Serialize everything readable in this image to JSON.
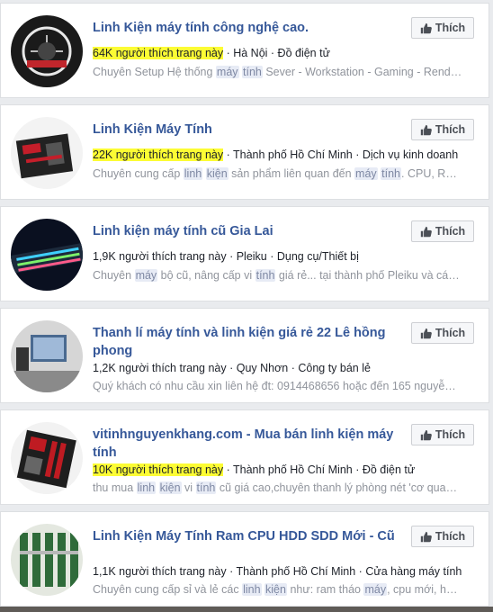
{
  "like_label": "Thích",
  "results": [
    {
      "title": "Linh Kiện máy tính công nghệ cao.",
      "likes": "64K người thích trang này",
      "highlight": true,
      "meta_rest": " · Hà Nội · Đồ điện tử",
      "desc": [
        {
          "t": "Chuyên Setup Hệ thống "
        },
        {
          "t": "máy",
          "k": true
        },
        {
          "t": " "
        },
        {
          "t": "tính",
          "k": true
        },
        {
          "t": " Sever - Workstation - Gaming - Rend…"
        }
      ]
    },
    {
      "title": "Linh Kiện Máy Tính",
      "likes": "22K người thích trang này",
      "highlight": true,
      "meta_rest": " · Thành phố Hồ Chí Minh · Dịch vụ kinh doanh",
      "desc": [
        {
          "t": "Chuyên cung cấp "
        },
        {
          "t": "linh",
          "k": true
        },
        {
          "t": " "
        },
        {
          "t": "kiện",
          "k": true
        },
        {
          "t": " sản phẩm liên quan đến "
        },
        {
          "t": "máy",
          "k": true
        },
        {
          "t": " "
        },
        {
          "t": "tính",
          "k": true
        },
        {
          "t": ". CPU, R…"
        }
      ]
    },
    {
      "title": "Linh kiện máy tính cũ Gia Lai",
      "likes": "1,9K người thích trang này",
      "highlight": false,
      "meta_rest": " · Pleiku · Dụng cụ/Thiết bị",
      "desc": [
        {
          "t": "Chuyên "
        },
        {
          "t": "máy",
          "k": true
        },
        {
          "t": " bộ cũ, nâng cấp vi "
        },
        {
          "t": "tính",
          "k": true
        },
        {
          "t": " giá rẻ... tại thành phố Pleiku và cá…"
        }
      ]
    },
    {
      "title": "Thanh lí máy tính và linh kiện giá rẻ 22 Lê hồng phong",
      "likes": "1,2K người thích trang này",
      "highlight": false,
      "meta_rest": " · Quy Nhơn · Công ty bán lẻ",
      "desc": [
        {
          "t": "Quý khách có nhu cầu xin liên hệ đt: 0914468656 hoặc đến 165 nguyễ…"
        }
      ]
    },
    {
      "title": "vitinhnguyenkhang.com - Mua bán linh kiện máy tính",
      "likes": "10K người thích trang này",
      "highlight": true,
      "meta_rest": " · Thành phố Hồ Chí Minh · Đồ điện tử",
      "desc": [
        {
          "t": "thu mua "
        },
        {
          "t": "linh",
          "k": true
        },
        {
          "t": " "
        },
        {
          "t": "kiện",
          "k": true
        },
        {
          "t": " vi "
        },
        {
          "t": "tính",
          "k": true
        },
        {
          "t": " cũ giá cao,chuyên thanh lý phòng nét 'cơ qua…"
        }
      ]
    },
    {
      "title": "Linh Kiện Máy Tính Ram CPU HDD SDD Mới - Cũ",
      "likes": "1,1K người thích trang này",
      "highlight": false,
      "meta_rest": " · Thành phố Hồ Chí Minh · Cửa hàng ",
      "meta_tail": [
        {
          "t": "máy",
          "k": true
        },
        {
          "t": " "
        },
        {
          "t": "tính",
          "k": true
        }
      ],
      "desc": [
        {
          "t": "Chuyên cung cấp sỉ và lẻ các "
        },
        {
          "t": "linh",
          "k": true
        },
        {
          "t": " "
        },
        {
          "t": "kiện",
          "k": true
        },
        {
          "t": " như: ram tháo "
        },
        {
          "t": "máy",
          "k": true
        },
        {
          "t": ", cpu mới, h…"
        }
      ]
    }
  ]
}
